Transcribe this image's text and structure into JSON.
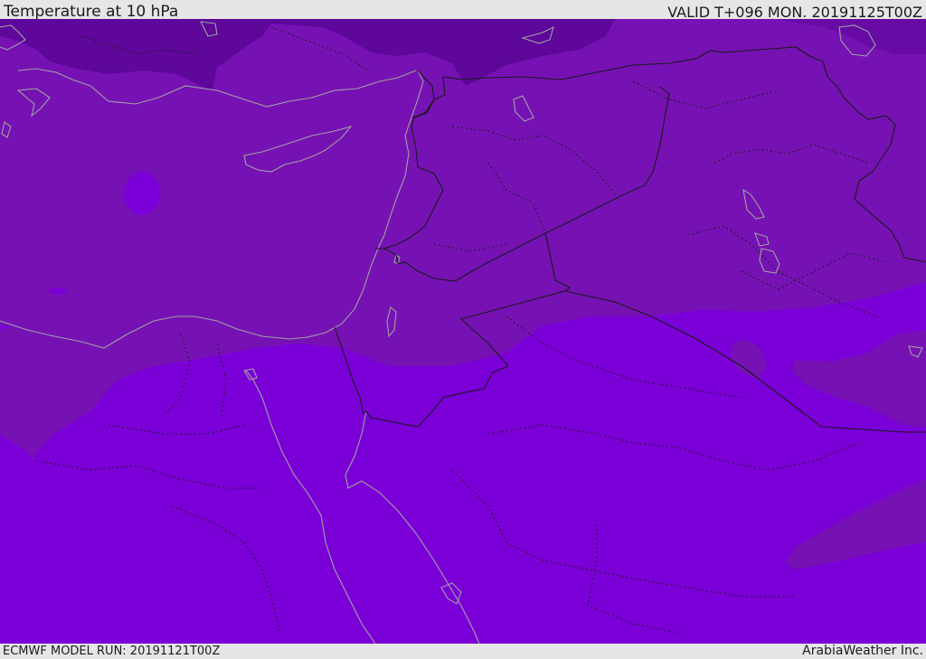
{
  "header": {
    "title": "Temperature at 10 hPa",
    "valid": "VALID T+096 MON. 20191125T00Z"
  },
  "footer": {
    "model_run": "ECMWF MODEL RUN: 20191121T00Z",
    "credit": "ArabiaWeather Inc."
  },
  "colors": {
    "cold_band_dark": "#5e079a",
    "band_mid": "#7612b4",
    "band_light": "#7b00d8",
    "borders": "#1a1a1a",
    "coastline": "#a0a0a0"
  }
}
